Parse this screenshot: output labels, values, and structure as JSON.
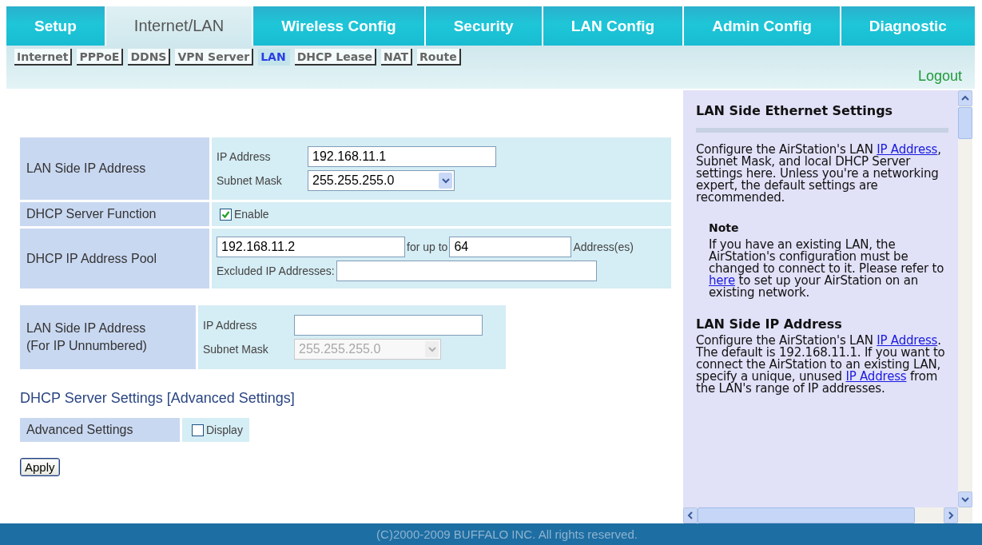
{
  "main_tabs": [
    {
      "label": "Setup",
      "selected": false
    },
    {
      "label": "Internet/LAN",
      "selected": true
    },
    {
      "label": "Wireless Config",
      "selected": false
    },
    {
      "label": "Security",
      "selected": false
    },
    {
      "label": "LAN Config",
      "selected": false
    },
    {
      "label": "Admin Config",
      "selected": false
    },
    {
      "label": "Diagnostic",
      "selected": false
    }
  ],
  "sub_tabs": [
    {
      "label": "Internet",
      "selected": false
    },
    {
      "label": "PPPoE",
      "selected": false
    },
    {
      "label": "DDNS",
      "selected": false
    },
    {
      "label": "VPN Server",
      "selected": false
    },
    {
      "label": "LAN",
      "selected": true
    },
    {
      "label": "DHCP Lease",
      "selected": false
    },
    {
      "label": "NAT",
      "selected": false
    },
    {
      "label": "Route",
      "selected": false
    }
  ],
  "logout": "Logout",
  "settings_tables": [
    {
      "rows": [
        {
          "kind": "ip_mask",
          "label": "LAN Side IP Address",
          "ip_label": "IP Address",
          "ip_value": "192.168.11.1",
          "mask_label": "Subnet Mask",
          "mask_value": "255.255.255.0",
          "disabled": false
        },
        {
          "kind": "checkbox",
          "label": "DHCP Server Function",
          "option": "Enable",
          "checked": true
        },
        {
          "kind": "pool",
          "label": "DHCP IP Address Pool",
          "start_value": "192.168.11.2",
          "count_label": "for up to",
          "count_value": "64",
          "unit": "Address(es)",
          "excluded_label": "Excluded IP Addresses:"
        }
      ]
    },
    {
      "rows": [
        {
          "kind": "ip_mask",
          "label": "LAN Side IP Address\n(For IP Unnumbered)",
          "ip_label": "IP Address",
          "mask_label": "Subnet Mask",
          "mask_value": "255.255.255.0",
          "disabled": true
        }
      ]
    }
  ],
  "advanced": {
    "heading": "DHCP Server Settings [Advanced Settings]",
    "rows": [
      {
        "kind": "checkbox",
        "label": "Advanced Settings",
        "option": "Display",
        "checked": false
      }
    ]
  },
  "apply_button": "Apply",
  "help": [
    {
      "kind": "heading",
      "text": "LAN Side Ethernet Settings"
    },
    {
      "kind": "rule"
    },
    {
      "kind": "paragraph",
      "parts": [
        {
          "text": "Configure the AirStation's LAN "
        },
        {
          "link": "IP Address"
        },
        {
          "text": ", Subnet Mask, and local DHCP Server settings here. Unless you're a networking expert, the default settings are recommended."
        }
      ]
    },
    {
      "kind": "note_heading",
      "text": "Note"
    },
    {
      "kind": "note_paragraph",
      "parts": [
        {
          "text": "If you have an existing LAN, the AirStation's configuration must be changed to connect to it. Please refer to "
        },
        {
          "link": "here"
        },
        {
          "text": " to set up your AirStation on an existing network."
        }
      ]
    },
    {
      "kind": "heading",
      "text": "LAN Side IP Address"
    },
    {
      "kind": "paragraph",
      "parts": [
        {
          "text": "Configure the AirStation's LAN "
        },
        {
          "link": "IP Address"
        },
        {
          "text": ". The default is 192.168.11.1. If you want to connect the AirStation to an existing LAN, specify a unique, unused "
        },
        {
          "link": "IP Address"
        },
        {
          "text": " from the LAN's range of IP addresses."
        }
      ]
    }
  ],
  "footer": "(C)2000-2009 BUFFALO INC. All rights reserved."
}
